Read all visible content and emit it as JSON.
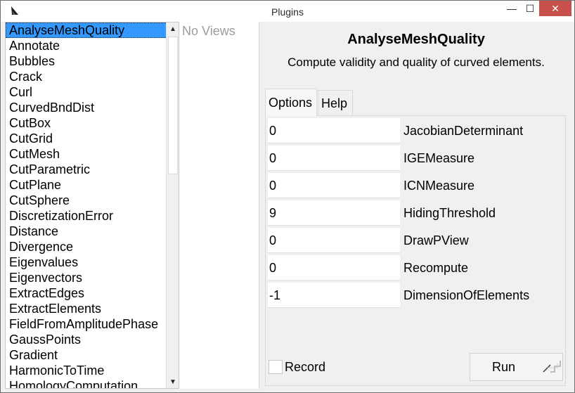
{
  "window": {
    "title": "Plugins",
    "minimize_glyph": "—",
    "maximize_glyph": "☐",
    "close_glyph": "✕"
  },
  "plugins": {
    "selected_index": 0,
    "items": [
      "AnalyseMeshQuality",
      "Annotate",
      "Bubbles",
      "Crack",
      "Curl",
      "CurvedBndDist",
      "CutBox",
      "CutGrid",
      "CutMesh",
      "CutParametric",
      "CutPlane",
      "CutSphere",
      "DiscretizationError",
      "Distance",
      "Divergence",
      "Eigenvalues",
      "Eigenvectors",
      "ExtractEdges",
      "ExtractElements",
      "FieldFromAmplitudePhase",
      "GaussPoints",
      "Gradient",
      "HarmonicToTime",
      "HomologyComputation"
    ],
    "scroll_up_glyph": "▲",
    "scroll_down_glyph": "▼"
  },
  "views": {
    "empty_text": "No Views"
  },
  "detail": {
    "title": "AnalyseMeshQuality",
    "description": "Compute validity and quality of curved elements."
  },
  "tabs": {
    "options_label": "Options",
    "help_label": "Help",
    "active": "Options"
  },
  "options": [
    {
      "value": "0",
      "label": "JacobianDeterminant"
    },
    {
      "value": "0",
      "label": "IGEMeasure"
    },
    {
      "value": "0",
      "label": "ICNMeasure"
    },
    {
      "value": "9",
      "label": "HidingThreshold"
    },
    {
      "value": "0",
      "label": "DrawPView"
    },
    {
      "value": "0",
      "label": "Recompute"
    },
    {
      "value": "-1",
      "label": "DimensionOfElements"
    }
  ],
  "record": {
    "label": "Record",
    "checked": false
  },
  "run": {
    "label": "Run"
  },
  "colors": {
    "selection": "#3399ff",
    "close_button": "#c7504b",
    "placeholder_text": "#9c9c9c"
  }
}
